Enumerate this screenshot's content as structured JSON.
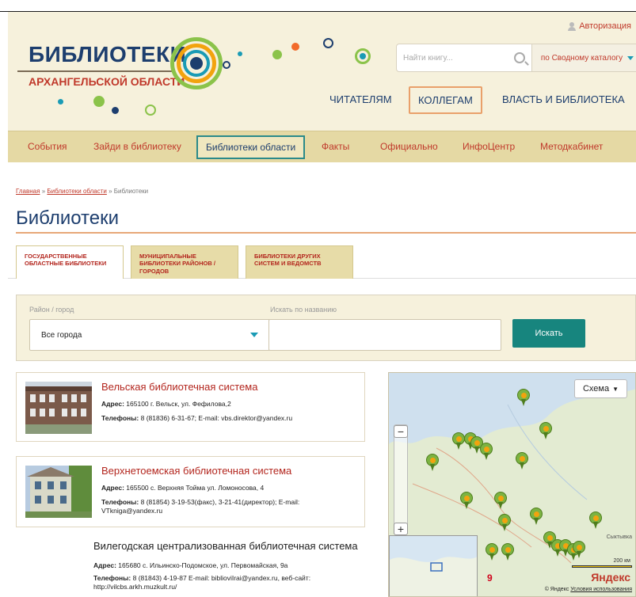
{
  "header": {
    "auth_label": "Авторизация",
    "logo_line1": "БИБЛИОТЕКИ",
    "logo_line2": "АРХАНГЕЛЬСКОЙ ОБЛАСТИ",
    "search_placeholder": "Найти книгу...",
    "search_scope": "по Сводному каталогу",
    "top_nav": [
      "ЧИТАТЕЛЯМ",
      "КОЛЛЕГАМ",
      "ВЛАСТЬ И БИБЛИОТЕКА"
    ]
  },
  "main_nav": [
    "События",
    "Зайди в библиотеку",
    "Библиотеки области",
    "Факты",
    "Официально",
    "ИнфоЦентр",
    "Методкабинет"
  ],
  "breadcrumb": {
    "home": "Главная",
    "sep": "»",
    "parent": "Библиотеки области",
    "current": "Библиотеки"
  },
  "page_title": "Библиотеки",
  "tabs": [
    {
      "label": "ГОСУДАРСТВЕННЫЕ ОБЛАСТНЫЕ БИБЛИОТЕКИ"
    },
    {
      "label": "МУНИЦИПАЛЬНЫЕ БИБЛИОТЕКИ РАЙОНОВ / ГОРОДОВ"
    },
    {
      "label": "БИБЛИОТЕКИ ДРУГИХ СИСТЕМ И ВЕДОМСТВ"
    }
  ],
  "filter": {
    "district_label": "Район / город",
    "district_value": "Все города",
    "name_label": "Искать по названию",
    "name_value": "",
    "button_label": "Искать"
  },
  "libraries": [
    {
      "name": "Вельская библиотечная система",
      "address_label": "Адрес:",
      "address": "165100 г. Вельск, ул. Фефилова,2",
      "phones_label": "Телефоны:",
      "phones": "8 (81836) 6-31-67; E-mail: vbs.direktor@yandex.ru"
    },
    {
      "name": "Верхнетоемская библиотечная система",
      "address_label": "Адрес:",
      "address": "165500 с. Верхняя Тойма ул. Ломоносова, 4",
      "phones_label": "Телефоны:",
      "phones": "8 (81854) 3-19-53(факс), 3-21-41(директор); E-mail: VTkniga@yandex.ru"
    },
    {
      "name": "Вилегодская централизованная библиотечная система",
      "address_label": "Адрес:",
      "address": "165680 с. Ильинско-Подомское, ул. Первомайская, 9а",
      "phones_label": "Телефоны:",
      "phones": "8 (81843) 4-19-87 E-mail: biblioviIrai@yandex.ru, веб-сайт: http://vilcbs.arkh.muzkult.ru/"
    }
  ],
  "map": {
    "scheme_label": "Схема",
    "city_label": "Сыктывка",
    "scale_label": "200 км",
    "provider": "Яндекс",
    "copyright": "© Яндекс",
    "terms": "Условия использования",
    "marker_count": 20
  },
  "colors": {
    "header_bg": "#f6f1dc",
    "nav_bg": "#e5d9a4",
    "brand_red": "#c0392b",
    "brand_blue": "#1d3e6e",
    "accent_teal": "#17857e"
  }
}
